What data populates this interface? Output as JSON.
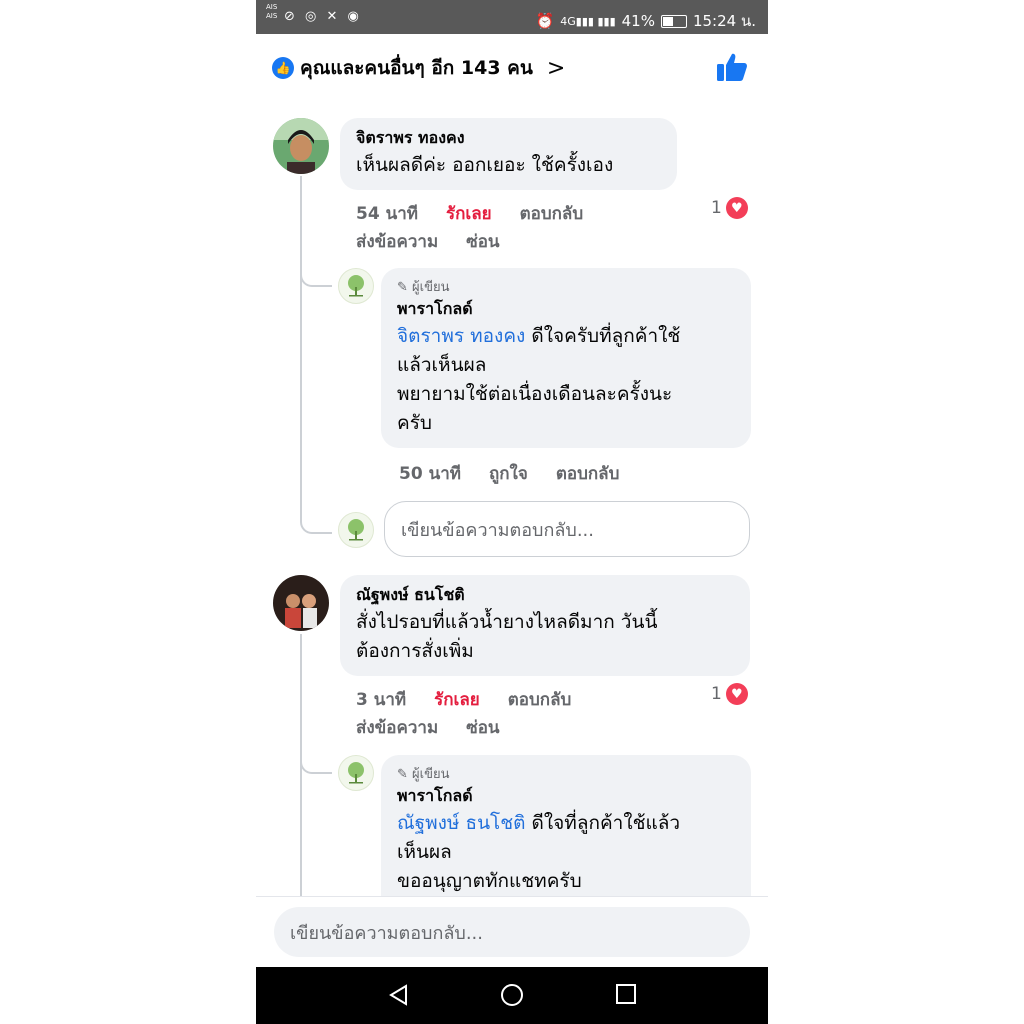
{
  "status_bar": {
    "carrier": "AIS\nAIS",
    "battery_percent": "41%",
    "time": "15:24 น."
  },
  "header": {
    "reactions_summary": "คุณและคนอื่นๆ อีก 143 คน"
  },
  "comments": [
    {
      "author": "จิตราพร ทองคง",
      "text": "เห็นผลดีค่ะ ออกเยอะ ใช้ครั้งเอง",
      "time": "54 นาที",
      "love_label": "รักเลย",
      "reply_label": "ตอบกลับ",
      "send_message_label": "ส่งข้อความ",
      "hide_label": "ซ่อน",
      "reaction_count": "1",
      "reply": {
        "author_badge": "ผู้เขียน",
        "author": "พาราโกลด์",
        "mention": "จิตราพร ทองคง",
        "text_line1": " ดีใจครับที่ลูกค้าใช้",
        "text_line2": "แล้วเห็นผล",
        "text_line3": "พยายามใช้ต่อเนื่องเดือนละครั้งนะ",
        "text_line4": "ครับ",
        "time": "50 นาที",
        "like_label": "ถูกใจ",
        "reply_label": "ตอบกลับ"
      },
      "reply_placeholder": "เขียนข้อความตอบกลับ..."
    },
    {
      "author": "ณัฐพงษ์ ธนโชติ",
      "text_line1": "สั่งไปรอบที่แล้วน้ำยางไหลดีมาก วันนี้",
      "text_line2": "ต้องการสั่งเพิ่ม",
      "time": "3 นาที",
      "love_label": "รักเลย",
      "reply_label": "ตอบกลับ",
      "send_message_label": "ส่งข้อความ",
      "hide_label": "ซ่อน",
      "reaction_count": "1",
      "reply": {
        "author_badge": "ผู้เขียน",
        "author": "พาราโกลด์",
        "mention": "ณัฐพงษ์ ธนโชติ",
        "text_line1": " ดีใจที่ลูกค้าใช้แล้ว",
        "text_line2": "เห็นผล",
        "text_line3": "ขออนุญาตทักแชทครับ"
      }
    }
  ],
  "bottom_input": {
    "placeholder": "เขียนข้อความตอบกลับ..."
  }
}
